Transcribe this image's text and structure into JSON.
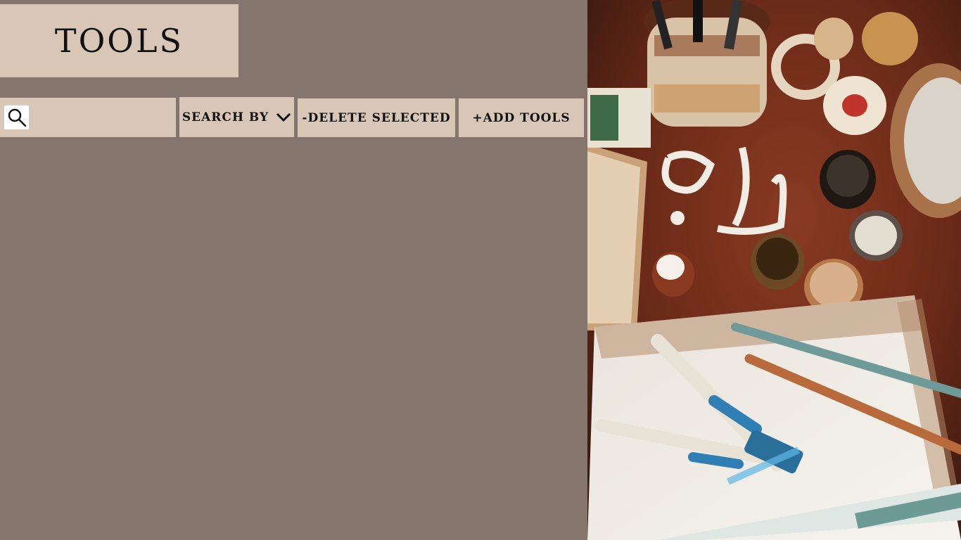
{
  "header": {
    "title": "TOOLS"
  },
  "toolbar": {
    "search": {
      "value": "",
      "placeholder": "",
      "icon": "search-icon"
    },
    "search_by_label": "SEARCH BY",
    "search_by_icon": "chevron-down-icon",
    "delete_label": "-DELETE SELECTED",
    "add_label": "+ADD TOOLS"
  },
  "colors": {
    "background": "#85766d",
    "panel": "#d8c7b6",
    "text": "#111111"
  },
  "hero_image": {
    "description": "calligraphy-tools-desk-photo"
  }
}
